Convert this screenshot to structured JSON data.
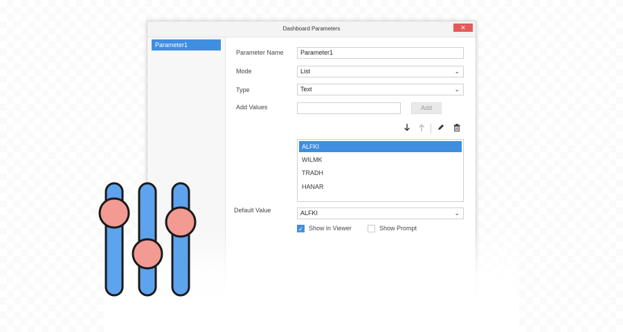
{
  "window": {
    "title": "Dashboard Parameters",
    "close_glyph": "✕"
  },
  "sidebar": {
    "items": [
      {
        "label": "Parameter1",
        "selected": true
      }
    ]
  },
  "form": {
    "name_label": "Parameter Name",
    "name_value": "Parameter1",
    "mode_label": "Mode",
    "mode_value": "List",
    "type_label": "Type",
    "type_value": "Text",
    "add_values_label": "Add Values",
    "add_values_input": "",
    "add_button": "Add",
    "default_label": "Default Value",
    "default_value": "ALFKI",
    "show_in_viewer_label": "Show in Viewer",
    "show_in_viewer_checked": true,
    "show_prompt_label": "Show Prompt",
    "show_prompt_checked": false
  },
  "toolbar": {
    "move_down_icon": "arrow-down-icon",
    "move_up_icon": "arrow-up-icon",
    "edit_icon": "pencil-icon",
    "delete_icon": "trash-icon"
  },
  "values_list": {
    "items": [
      "ALFKI",
      "WILMK",
      "TRADH",
      "HANAR"
    ],
    "selected": "ALFKI"
  },
  "colors": {
    "accent": "#3f8ee0",
    "close": "#e45b5b",
    "slider_track": "#5ea3ee",
    "slider_knob": "#f39a93"
  },
  "illustration": {
    "icon": "sliders-icon"
  }
}
